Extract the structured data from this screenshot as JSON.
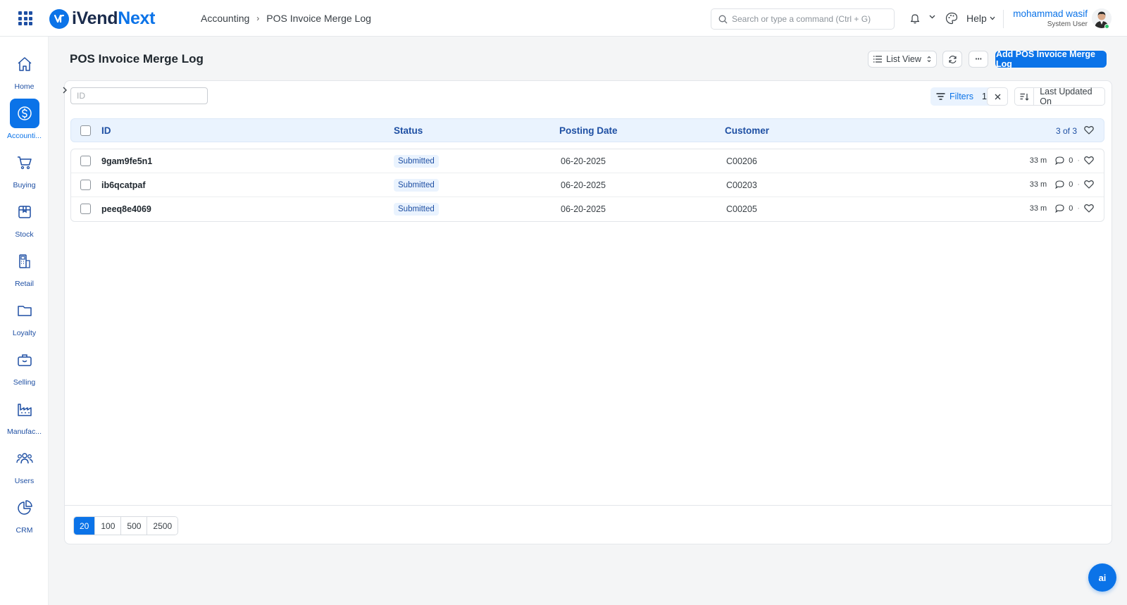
{
  "app": {
    "logo_a": "iVend",
    "logo_b": "Next"
  },
  "breadcrumb": {
    "parent": "Accounting",
    "sep": "›",
    "current": "POS Invoice Merge Log"
  },
  "search": {
    "placeholder": "Search or type a command (Ctrl + G)"
  },
  "help": {
    "label": "Help"
  },
  "user": {
    "name": "mohammad wasif",
    "role": "System User"
  },
  "sidebar": {
    "items": [
      {
        "label": "Home",
        "icon": "home-icon"
      },
      {
        "label": "Accounti...",
        "icon": "dollar-icon",
        "active": true
      },
      {
        "label": "Buying",
        "icon": "cart-icon"
      },
      {
        "label": "Stock",
        "icon": "box-icon"
      },
      {
        "label": "Retail",
        "icon": "pos-icon"
      },
      {
        "label": "Loyalty",
        "icon": "folder-icon"
      },
      {
        "label": "Selling",
        "icon": "bag-icon"
      },
      {
        "label": "Manufac...",
        "icon": "factory-icon"
      },
      {
        "label": "Users",
        "icon": "users-icon"
      },
      {
        "label": "CRM",
        "icon": "pie-icon"
      }
    ]
  },
  "page": {
    "title": "POS Invoice Merge Log",
    "list_view_label": "List View",
    "more_label": "···",
    "add_label": "Add POS Invoice Merge Log"
  },
  "filters": {
    "id_placeholder": "ID",
    "filters_label": "Filters",
    "filters_count": "1",
    "sort_label": "Last Updated On"
  },
  "table": {
    "columns": [
      "ID",
      "Status",
      "Posting Date",
      "Customer"
    ],
    "count": "3 of 3",
    "rows": [
      {
        "id": "9gam9fe5n1",
        "status": "Submitted",
        "posting_date": "06-20-2025",
        "customer": "C00206",
        "age": "33 m",
        "comments": "0"
      },
      {
        "id": "ib6qcatpaf",
        "status": "Submitted",
        "posting_date": "06-20-2025",
        "customer": "C00203",
        "age": "33 m",
        "comments": "0"
      },
      {
        "id": "peeq8e4069",
        "status": "Submitted",
        "posting_date": "06-20-2025",
        "customer": "C00205",
        "age": "33 m",
        "comments": "0"
      }
    ]
  },
  "paging": {
    "options": [
      "20",
      "100",
      "500",
      "2500"
    ],
    "selected": "20"
  },
  "ai_button": {
    "label": "ai"
  },
  "colors": {
    "accent": "#0b73e8",
    "navy": "#1e4fa3",
    "online": "#2ec46b"
  }
}
